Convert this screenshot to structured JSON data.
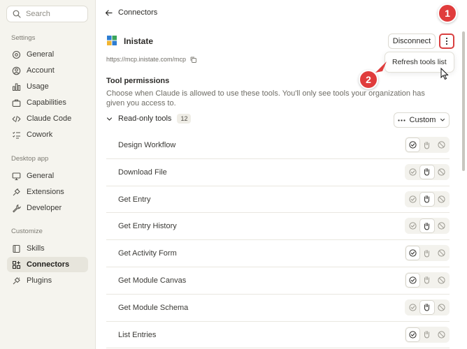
{
  "sidebar": {
    "search": {
      "placeholder": "Search"
    },
    "sections": [
      {
        "label": "Settings",
        "items": [
          {
            "label": "General",
            "icon": "sliders-icon"
          },
          {
            "label": "Account",
            "icon": "user-circle-icon"
          },
          {
            "label": "Usage",
            "icon": "bar-chart-icon"
          },
          {
            "label": "Capabilities",
            "icon": "briefcase-icon"
          },
          {
            "label": "Claude Code",
            "icon": "code-icon"
          },
          {
            "label": "Cowork",
            "icon": "checklist-icon"
          }
        ]
      },
      {
        "label": "Desktop app",
        "items": [
          {
            "label": "General",
            "icon": "monitor-icon"
          },
          {
            "label": "Extensions",
            "icon": "plug-icon"
          },
          {
            "label": "Developer",
            "icon": "wrench-icon"
          }
        ]
      },
      {
        "label": "Customize",
        "items": [
          {
            "label": "Skills",
            "icon": "book-icon"
          },
          {
            "label": "Connectors",
            "icon": "grid-plus-icon",
            "active": true
          },
          {
            "label": "Plugins",
            "icon": "plug-icon"
          }
        ]
      }
    ]
  },
  "header": {
    "back_label": "Connectors"
  },
  "connector": {
    "name": "Inistate",
    "url": "https://mcp.inistate.com/mcp",
    "disconnect_label": "Disconnect",
    "menu_item": "Refresh tools list"
  },
  "annotations": {
    "step1": "1",
    "step2": "2",
    "color": "#e03c3c"
  },
  "permissions": {
    "title": "Tool permissions",
    "description": "Choose when Claude is allowed to use these tools. You'll only see tools your organization has given you access to.",
    "group_label": "Read-only tools",
    "group_count": "12",
    "mode_label": "Custom",
    "tools": [
      {
        "name": "Design Workflow",
        "mode": "allow"
      },
      {
        "name": "Download File",
        "mode": "ask"
      },
      {
        "name": "Get Entry",
        "mode": "ask"
      },
      {
        "name": "Get Entry History",
        "mode": "ask"
      },
      {
        "name": "Get Activity Form",
        "mode": "allow"
      },
      {
        "name": "Get Module Canvas",
        "mode": "allow"
      },
      {
        "name": "Get Module Schema",
        "mode": "ask"
      },
      {
        "name": "List Entries",
        "mode": "allow"
      }
    ]
  }
}
